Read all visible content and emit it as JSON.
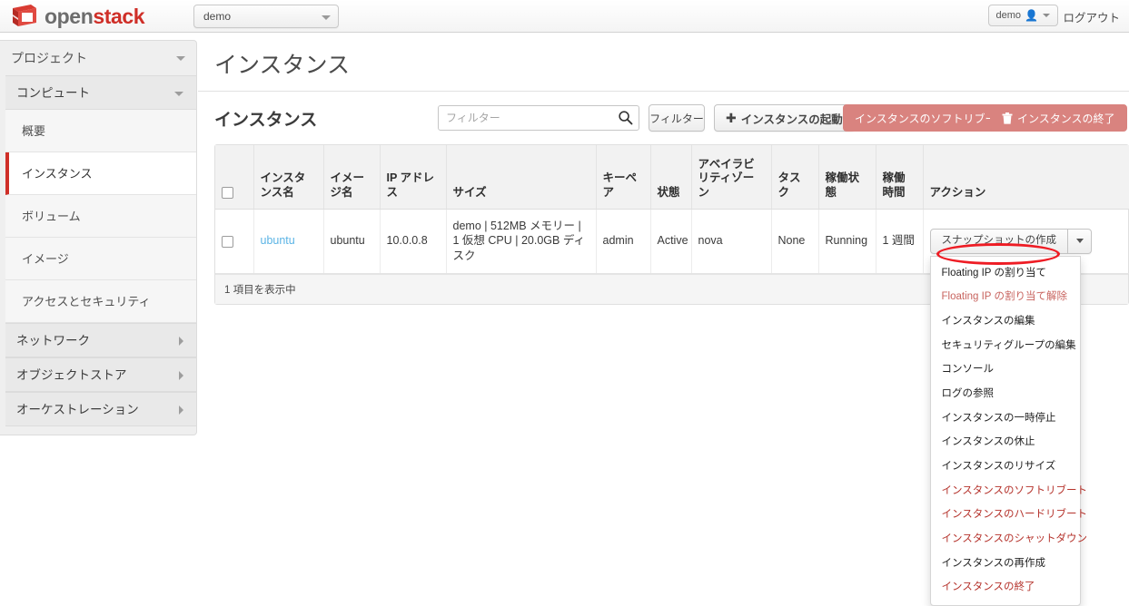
{
  "topbar": {
    "brand_open": "open",
    "brand_stack": "stack",
    "brand_logo_icon": "openstack-cube-logo",
    "project_select_value": "demo",
    "project_select_icon": "chevron-down-icon",
    "user_label": "demo",
    "user_icon": "person-icon",
    "user_caret_icon": "chevron-down-icon",
    "logout_label": "ログアウト"
  },
  "sidebar": {
    "header": "プロジェクト",
    "header_icon": "chevron-down-icon",
    "group_compute": "コンピュート",
    "group_compute_icon": "chevron-down-icon",
    "items": [
      {
        "label": "概要",
        "active": false
      },
      {
        "label": "インスタンス",
        "active": true
      },
      {
        "label": "ボリューム",
        "active": false
      },
      {
        "label": "イメージ",
        "active": false
      },
      {
        "label": "アクセスとセキュリティ",
        "active": false
      }
    ],
    "groups": [
      {
        "label": "ネットワーク",
        "icon": "chevron-right-icon"
      },
      {
        "label": "オブジェクトストア",
        "icon": "chevron-right-icon"
      },
      {
        "label": "オーケストレーション",
        "icon": "chevron-right-icon"
      }
    ]
  },
  "main": {
    "page_title": "インスタンス",
    "section_title": "インスタンス",
    "filter_placeholder": "フィルター",
    "filter_value": "",
    "search_icon": "search-icon",
    "buttons": {
      "filter": "フィルター",
      "launch": "インスタンスの起動",
      "launch_icon": "plus-icon",
      "soft_reboot": "インスタンスのソフトリブート",
      "terminate": "インスタンスの終了",
      "terminate_icon": "trash-icon"
    },
    "table": {
      "headers": [
        "",
        "インスタンス名",
        "イメージ名",
        "IP アドレス",
        "サイズ",
        "キーペア",
        "状態",
        "アベイラビリティゾーン",
        "タスク",
        "稼働状態",
        "稼働時間",
        "アクション"
      ],
      "rows": [
        {
          "checkbox": "",
          "instance_name": "ubuntu",
          "image_name": "ubuntu",
          "ip_address": "10.0.0.8",
          "size": "demo | 512MB メモリー | 1 仮想 CPU | 20.0GB ディスク",
          "keypair": "admin",
          "status": "Active",
          "availability_zone": "nova",
          "task": "None",
          "power_state": "Running",
          "uptime": "1 週間",
          "action_label": "スナップショットの作成",
          "action_caret_icon": "chevron-down-icon"
        }
      ],
      "footer": "1 項目を表示中"
    },
    "dropdown": {
      "items": [
        {
          "label": "Floating IP の割り当て",
          "style": "normal",
          "highlighted": true
        },
        {
          "label": "Floating IP の割り当て解除",
          "style": "muted"
        },
        {
          "label": "インスタンスの編集",
          "style": "normal"
        },
        {
          "label": "セキュリティグループの編集",
          "style": "normal"
        },
        {
          "label": "コンソール",
          "style": "normal"
        },
        {
          "label": "ログの参照",
          "style": "normal"
        },
        {
          "label": "インスタンスの一時停止",
          "style": "normal"
        },
        {
          "label": "インスタンスの休止",
          "style": "normal"
        },
        {
          "label": "インスタンスのリサイズ",
          "style": "normal"
        },
        {
          "label": "インスタンスのソフトリブート",
          "style": "danger"
        },
        {
          "label": "インスタンスのハードリブート",
          "style": "danger"
        },
        {
          "label": "インスタンスのシャットダウン",
          "style": "danger"
        },
        {
          "label": "インスタンスの再作成",
          "style": "normal"
        },
        {
          "label": "インスタンスの終了",
          "style": "danger"
        }
      ],
      "annotation_icon": "red-ellipse-highlight"
    }
  },
  "colors": {
    "brand_red": "#cf2f28",
    "link_blue": "#5bb4e5",
    "danger_button": "#d9837f",
    "annotation_red": "#ee1c24",
    "menu_danger_text": "#b5332c"
  }
}
